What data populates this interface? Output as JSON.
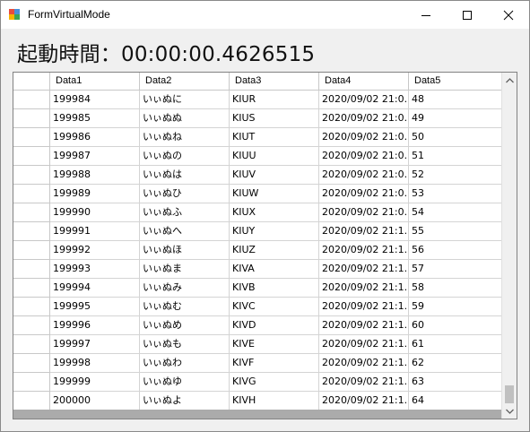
{
  "window": {
    "title": "FormVirtualMode"
  },
  "heading": "起動時間：00:00:00.4626515",
  "grid": {
    "columns": [
      "Data1",
      "Data2",
      "Data3",
      "Data4",
      "Data5"
    ],
    "rows": [
      [
        "199984",
        "いぃぬに",
        "KIUR",
        "2020/09/02 21:0...",
        "48"
      ],
      [
        "199985",
        "いぃぬぬ",
        "KIUS",
        "2020/09/02 21:0...",
        "49"
      ],
      [
        "199986",
        "いぃぬね",
        "KIUT",
        "2020/09/02 21:0...",
        "50"
      ],
      [
        "199987",
        "いぃぬの",
        "KIUU",
        "2020/09/02 21:0...",
        "51"
      ],
      [
        "199988",
        "いぃぬは",
        "KIUV",
        "2020/09/02 21:0...",
        "52"
      ],
      [
        "199989",
        "いぃぬひ",
        "KIUW",
        "2020/09/02 21:0...",
        "53"
      ],
      [
        "199990",
        "いぃぬふ",
        "KIUX",
        "2020/09/02 21:0...",
        "54"
      ],
      [
        "199991",
        "いぃぬへ",
        "KIUY",
        "2020/09/02 21:1...",
        "55"
      ],
      [
        "199992",
        "いぃぬほ",
        "KIUZ",
        "2020/09/02 21:1...",
        "56"
      ],
      [
        "199993",
        "いぃぬま",
        "KIVA",
        "2020/09/02 21:1...",
        "57"
      ],
      [
        "199994",
        "いぃぬみ",
        "KIVB",
        "2020/09/02 21:1...",
        "58"
      ],
      [
        "199995",
        "いぃぬむ",
        "KIVC",
        "2020/09/02 21:1...",
        "59"
      ],
      [
        "199996",
        "いぃぬめ",
        "KIVD",
        "2020/09/02 21:1...",
        "60"
      ],
      [
        "199997",
        "いぃぬも",
        "KIVE",
        "2020/09/02 21:1...",
        "61"
      ],
      [
        "199998",
        "いぃぬわ",
        "KIVF",
        "2020/09/02 21:1...",
        "62"
      ],
      [
        "199999",
        "いぃぬゆ",
        "KIVG",
        "2020/09/02 21:1...",
        "63"
      ],
      [
        "200000",
        "いぃぬよ",
        "KIVH",
        "2020/09/02 21:1...",
        "64"
      ]
    ],
    "scroll_position": 1.0
  },
  "icons": {
    "app": "winforms-app-icon",
    "minimize": "minimize-icon",
    "maximize": "maximize-icon",
    "close": "close-icon",
    "scroll_up": "scroll-up-arrow-icon",
    "scroll_down": "scroll-down-arrow-icon"
  },
  "colors": {
    "grid_background": "#ababab",
    "window_background": "#f0f0f0",
    "titlebar": "#ffffff"
  }
}
